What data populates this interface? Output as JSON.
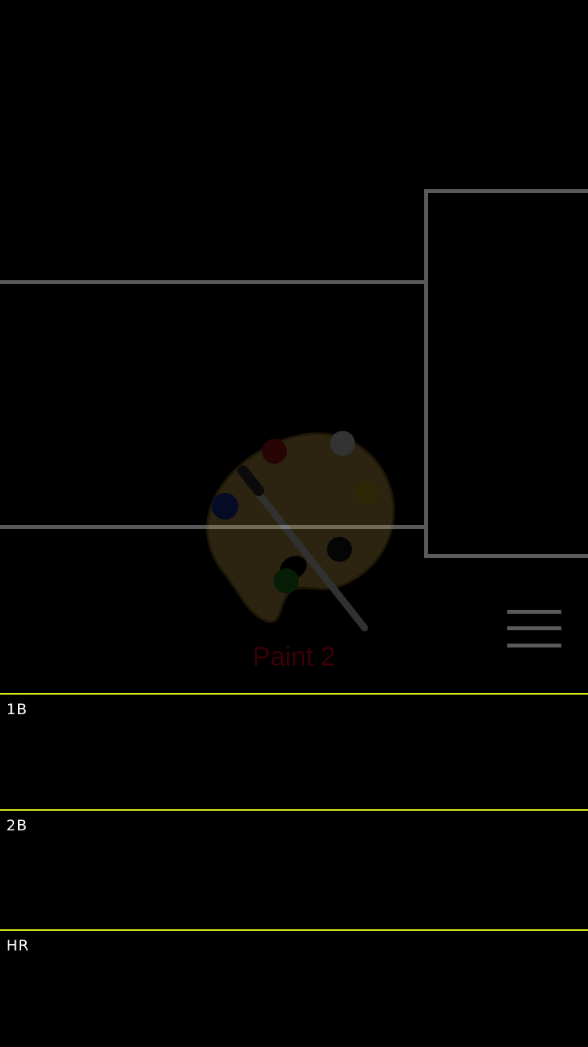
{
  "app": {
    "name": "Paint 2",
    "icon": "palette-icon"
  },
  "menu": {
    "icon": "hamburger-menu-icon"
  },
  "rows": [
    {
      "label": "1B"
    },
    {
      "label": "2B"
    },
    {
      "label": "HR"
    }
  ],
  "colors": {
    "background": "#000000",
    "frame_lines": "#5a5a5a",
    "row_divider": "#d8ef1d",
    "row_text": "#ffffff",
    "app_label": "#3a0008"
  }
}
